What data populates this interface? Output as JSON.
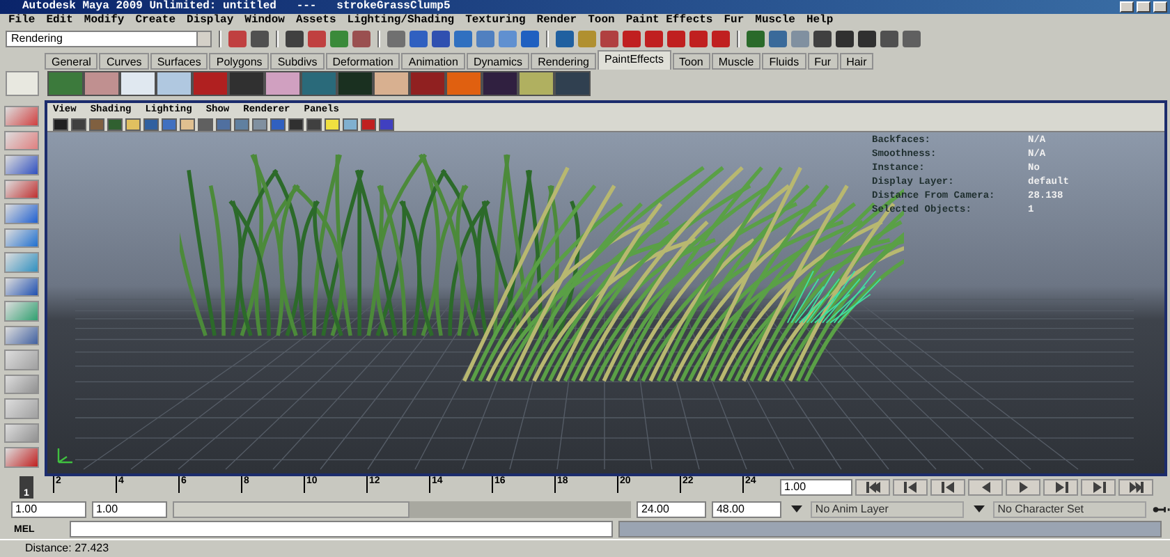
{
  "window": {
    "title": "Autodesk Maya 2009 Unlimited: untitled   ---   strokeGrassClump5"
  },
  "menu_bar": [
    "File",
    "Edit",
    "Modify",
    "Create",
    "Display",
    "Window",
    "Assets",
    "Lighting/Shading",
    "Texturing",
    "Render",
    "Toon",
    "Paint Effects",
    "Fur",
    "Muscle",
    "Help"
  ],
  "status_line": {
    "mode": "Rendering"
  },
  "shelf_tabs": [
    {
      "label": "General",
      "selected": false
    },
    {
      "label": "Curves",
      "selected": false
    },
    {
      "label": "Surfaces",
      "selected": false
    },
    {
      "label": "Polygons",
      "selected": false
    },
    {
      "label": "Subdivs",
      "selected": false
    },
    {
      "label": "Deformation",
      "selected": false
    },
    {
      "label": "Animation",
      "selected": false
    },
    {
      "label": "Dynamics",
      "selected": false
    },
    {
      "label": "Rendering",
      "selected": false
    },
    {
      "label": "PaintEffects",
      "selected": true
    },
    {
      "label": "Toon",
      "selected": false
    },
    {
      "label": "Muscle",
      "selected": false
    },
    {
      "label": "Fluids",
      "selected": false
    },
    {
      "label": "Fur",
      "selected": false
    },
    {
      "label": "Hair",
      "selected": false
    }
  ],
  "panel_menu": [
    "View",
    "Shading",
    "Lighting",
    "Show",
    "Renderer",
    "Panels"
  ],
  "hud": [
    {
      "label": "Backfaces:",
      "value": "N/A"
    },
    {
      "label": "Smoothness:",
      "value": "N/A"
    },
    {
      "label": "Instance:",
      "value": "No"
    },
    {
      "label": "Display Layer:",
      "value": "default"
    },
    {
      "label": "Distance From Camera:",
      "value": "28.138"
    },
    {
      "label": "Selected Objects:",
      "value": "1"
    }
  ],
  "time_slider": {
    "current_frame": "1",
    "level": 0,
    "ticks": [
      "2",
      "4",
      "6",
      "8",
      "10",
      "12",
      "14",
      "16",
      "18",
      "20",
      "22",
      "24"
    ]
  },
  "current_time": "1.00",
  "range_slider": {
    "start_time": "1.00",
    "playback_start": "1.00",
    "playback_end": "24.00",
    "end_time": "48.00"
  },
  "anim_layer": "No Anim Layer",
  "character_set": "No Character Set",
  "command_line": {
    "label": "MEL"
  },
  "help_line": "Distance: 27.423"
}
